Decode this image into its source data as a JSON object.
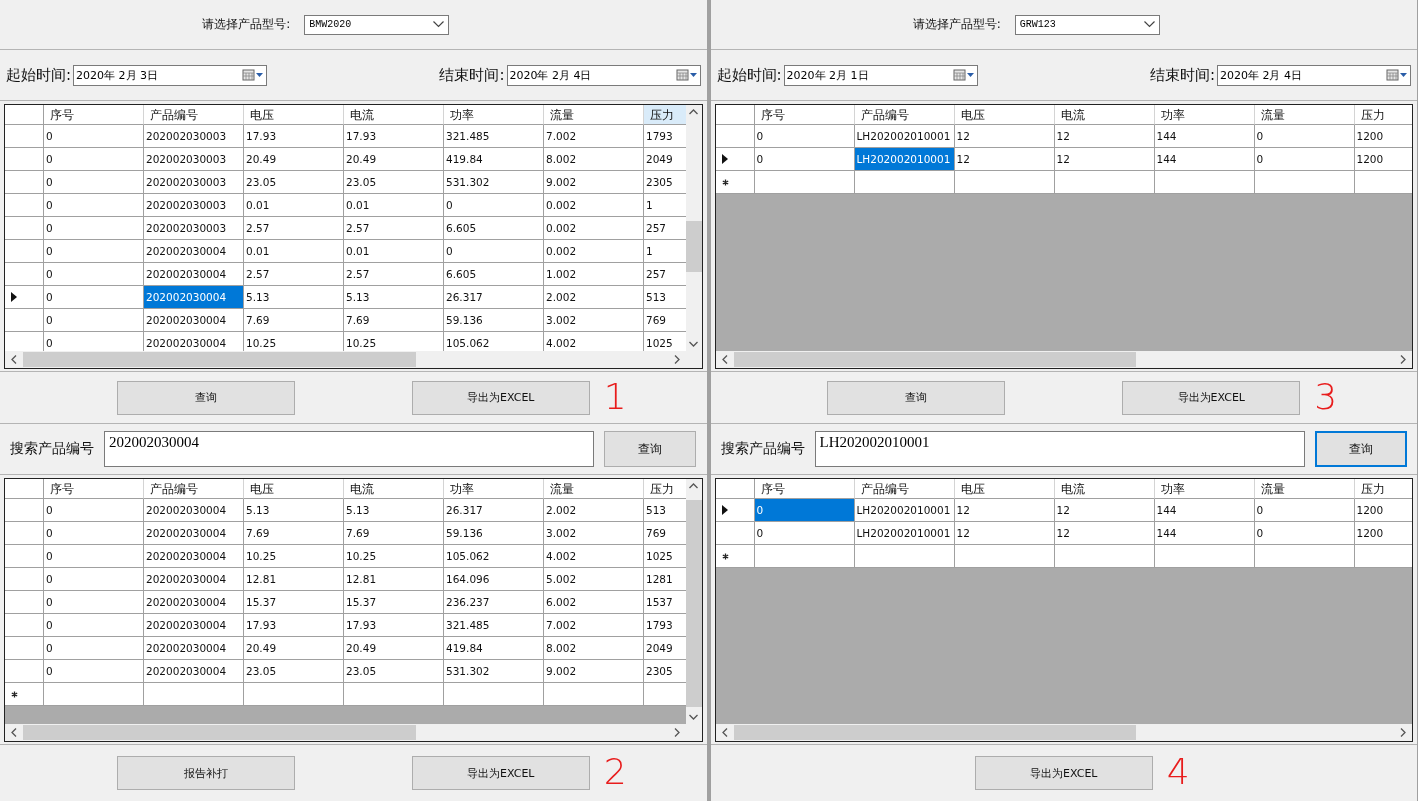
{
  "panels": [
    {
      "model": {
        "label": "请选择产品型号:",
        "value": "BMW2020"
      },
      "start": {
        "label": "起始时间:",
        "value": "2020年 2月 3日"
      },
      "end": {
        "label": "结束时间:",
        "value": "2020年 2月 4日"
      },
      "grid_top": {
        "vertical_scrollbar": true,
        "new_row": false,
        "columns": [
          {
            "label": "序号",
            "selected": false
          },
          {
            "label": "产品编号",
            "selected": false
          },
          {
            "label": "电压",
            "selected": false
          },
          {
            "label": "电流",
            "selected": false
          },
          {
            "label": "功率",
            "selected": false
          },
          {
            "label": "流量",
            "selected": false
          },
          {
            "label": "压力",
            "selected": true
          }
        ],
        "rows": [
          {
            "current": false,
            "cells": [
              "0",
              "202002030003",
              "17.93",
              "17.93",
              "321.485",
              "7.002",
              "1793"
            ],
            "cell_selected": [
              false,
              false,
              false,
              false,
              false,
              false,
              false
            ]
          },
          {
            "current": false,
            "cells": [
              "0",
              "202002030003",
              "20.49",
              "20.49",
              "419.84",
              "8.002",
              "2049"
            ],
            "cell_selected": [
              false,
              false,
              false,
              false,
              false,
              false,
              false
            ]
          },
          {
            "current": false,
            "cells": [
              "0",
              "202002030003",
              "23.05",
              "23.05",
              "531.302",
              "9.002",
              "2305"
            ],
            "cell_selected": [
              false,
              false,
              false,
              false,
              false,
              false,
              false
            ]
          },
          {
            "current": false,
            "cells": [
              "0",
              "202002030003",
              "0.01",
              "0.01",
              "0",
              "0.002",
              "1"
            ],
            "cell_selected": [
              false,
              false,
              false,
              false,
              false,
              false,
              false
            ]
          },
          {
            "current": false,
            "cells": [
              "0",
              "202002030003",
              "2.57",
              "2.57",
              "6.605",
              "0.002",
              "257"
            ],
            "cell_selected": [
              false,
              false,
              false,
              false,
              false,
              false,
              false
            ]
          },
          {
            "current": false,
            "cells": [
              "0",
              "202002030004",
              "0.01",
              "0.01",
              "0",
              "0.002",
              "1"
            ],
            "cell_selected": [
              false,
              false,
              false,
              false,
              false,
              false,
              false
            ]
          },
          {
            "current": false,
            "cells": [
              "0",
              "202002030004",
              "2.57",
              "2.57",
              "6.605",
              "1.002",
              "257"
            ],
            "cell_selected": [
              false,
              false,
              false,
              false,
              false,
              false,
              false
            ]
          },
          {
            "current": true,
            "cells": [
              "0",
              "202002030004",
              "5.13",
              "5.13",
              "26.317",
              "2.002",
              "513"
            ],
            "cell_selected": [
              false,
              true,
              false,
              false,
              false,
              false,
              false
            ]
          },
          {
            "current": false,
            "cells": [
              "0",
              "202002030004",
              "7.69",
              "7.69",
              "59.136",
              "3.002",
              "769"
            ],
            "cell_selected": [
              false,
              false,
              false,
              false,
              false,
              false,
              false
            ]
          },
          {
            "current": false,
            "cells": [
              "0",
              "202002030004",
              "10.25",
              "10.25",
              "105.062",
              "4.002",
              "1025"
            ],
            "cell_selected": [
              false,
              false,
              false,
              false,
              false,
              false,
              false
            ]
          }
        ]
      },
      "buttons_top": {
        "buttons": [
          "查询",
          "导出为EXCEL"
        ],
        "annotation": "1"
      },
      "search": {
        "label": "搜索产品编号",
        "value": "202002030004",
        "button": "查询",
        "button_focused": false
      },
      "grid_bottom": {
        "vertical_scrollbar": true,
        "new_row": true,
        "columns": [
          {
            "label": "序号",
            "selected": false
          },
          {
            "label": "产品编号",
            "selected": false
          },
          {
            "label": "电压",
            "selected": false
          },
          {
            "label": "电流",
            "selected": false
          },
          {
            "label": "功率",
            "selected": false
          },
          {
            "label": "流量",
            "selected": false
          },
          {
            "label": "压力",
            "selected": false
          }
        ],
        "rows": [
          {
            "current": false,
            "cells": [
              "0",
              "202002030004",
              "5.13",
              "5.13",
              "26.317",
              "2.002",
              "513"
            ],
            "cell_selected": [
              false,
              false,
              false,
              false,
              false,
              false,
              false
            ]
          },
          {
            "current": false,
            "cells": [
              "0",
              "202002030004",
              "7.69",
              "7.69",
              "59.136",
              "3.002",
              "769"
            ],
            "cell_selected": [
              false,
              false,
              false,
              false,
              false,
              false,
              false
            ]
          },
          {
            "current": false,
            "cells": [
              "0",
              "202002030004",
              "10.25",
              "10.25",
              "105.062",
              "4.002",
              "1025"
            ],
            "cell_selected": [
              false,
              false,
              false,
              false,
              false,
              false,
              false
            ]
          },
          {
            "current": false,
            "cells": [
              "0",
              "202002030004",
              "12.81",
              "12.81",
              "164.096",
              "5.002",
              "1281"
            ],
            "cell_selected": [
              false,
              false,
              false,
              false,
              false,
              false,
              false
            ]
          },
          {
            "current": false,
            "cells": [
              "0",
              "202002030004",
              "15.37",
              "15.37",
              "236.237",
              "6.002",
              "1537"
            ],
            "cell_selected": [
              false,
              false,
              false,
              false,
              false,
              false,
              false
            ]
          },
          {
            "current": false,
            "cells": [
              "0",
              "202002030004",
              "17.93",
              "17.93",
              "321.485",
              "7.002",
              "1793"
            ],
            "cell_selected": [
              false,
              false,
              false,
              false,
              false,
              false,
              false
            ]
          },
          {
            "current": false,
            "cells": [
              "0",
              "202002030004",
              "20.49",
              "20.49",
              "419.84",
              "8.002",
              "2049"
            ],
            "cell_selected": [
              false,
              false,
              false,
              false,
              false,
              false,
              false
            ]
          },
          {
            "current": false,
            "cells": [
              "0",
              "202002030004",
              "23.05",
              "23.05",
              "531.302",
              "9.002",
              "2305"
            ],
            "cell_selected": [
              false,
              false,
              false,
              false,
              false,
              false,
              false
            ]
          }
        ]
      },
      "buttons_bottom": {
        "buttons": [
          "报告补打",
          "导出为EXCEL"
        ],
        "annotation": "2"
      }
    },
    {
      "model": {
        "label": "请选择产品型号:",
        "value": "GRW123"
      },
      "start": {
        "label": "起始时间:",
        "value": "2020年 2月 1日"
      },
      "end": {
        "label": "结束时间:",
        "value": "2020年 2月 4日"
      },
      "grid_top": {
        "vertical_scrollbar": false,
        "new_row": true,
        "columns": [
          {
            "label": "序号",
            "selected": false
          },
          {
            "label": "产品编号",
            "selected": false
          },
          {
            "label": "电压",
            "selected": false
          },
          {
            "label": "电流",
            "selected": false
          },
          {
            "label": "功率",
            "selected": false
          },
          {
            "label": "流量",
            "selected": false
          },
          {
            "label": "压力",
            "selected": false
          }
        ],
        "rows": [
          {
            "current": false,
            "cells": [
              "0",
              "LH202002010001",
              "12",
              "12",
              "144",
              "0",
              "1200"
            ],
            "cell_selected": [
              false,
              false,
              false,
              false,
              false,
              false,
              false
            ]
          },
          {
            "current": true,
            "cells": [
              "0",
              "LH202002010001",
              "12",
              "12",
              "144",
              "0",
              "1200"
            ],
            "cell_selected": [
              false,
              true,
              false,
              false,
              false,
              false,
              false
            ]
          }
        ]
      },
      "buttons_top": {
        "buttons": [
          "查询",
          "导出为EXCEL"
        ],
        "annotation": "3"
      },
      "search": {
        "label": "搜索产品编号",
        "value": "LH202002010001",
        "button": "查询",
        "button_focused": true
      },
      "grid_bottom": {
        "vertical_scrollbar": false,
        "new_row": true,
        "columns": [
          {
            "label": "序号",
            "selected": false
          },
          {
            "label": "产品编号",
            "selected": false
          },
          {
            "label": "电压",
            "selected": false
          },
          {
            "label": "电流",
            "selected": false
          },
          {
            "label": "功率",
            "selected": false
          },
          {
            "label": "流量",
            "selected": false
          },
          {
            "label": "压力",
            "selected": false
          }
        ],
        "rows": [
          {
            "current": true,
            "cells": [
              "0",
              "LH202002010001",
              "12",
              "12",
              "144",
              "0",
              "1200"
            ],
            "cell_selected": [
              true,
              false,
              false,
              false,
              false,
              false,
              false
            ]
          },
          {
            "current": false,
            "cells": [
              "0",
              "LH202002010001",
              "12",
              "12",
              "144",
              "0",
              "1200"
            ],
            "cell_selected": [
              false,
              false,
              false,
              false,
              false,
              false,
              false
            ]
          }
        ]
      },
      "buttons_bottom": {
        "buttons": [
          "导出为EXCEL"
        ],
        "annotation": "4"
      }
    }
  ]
}
